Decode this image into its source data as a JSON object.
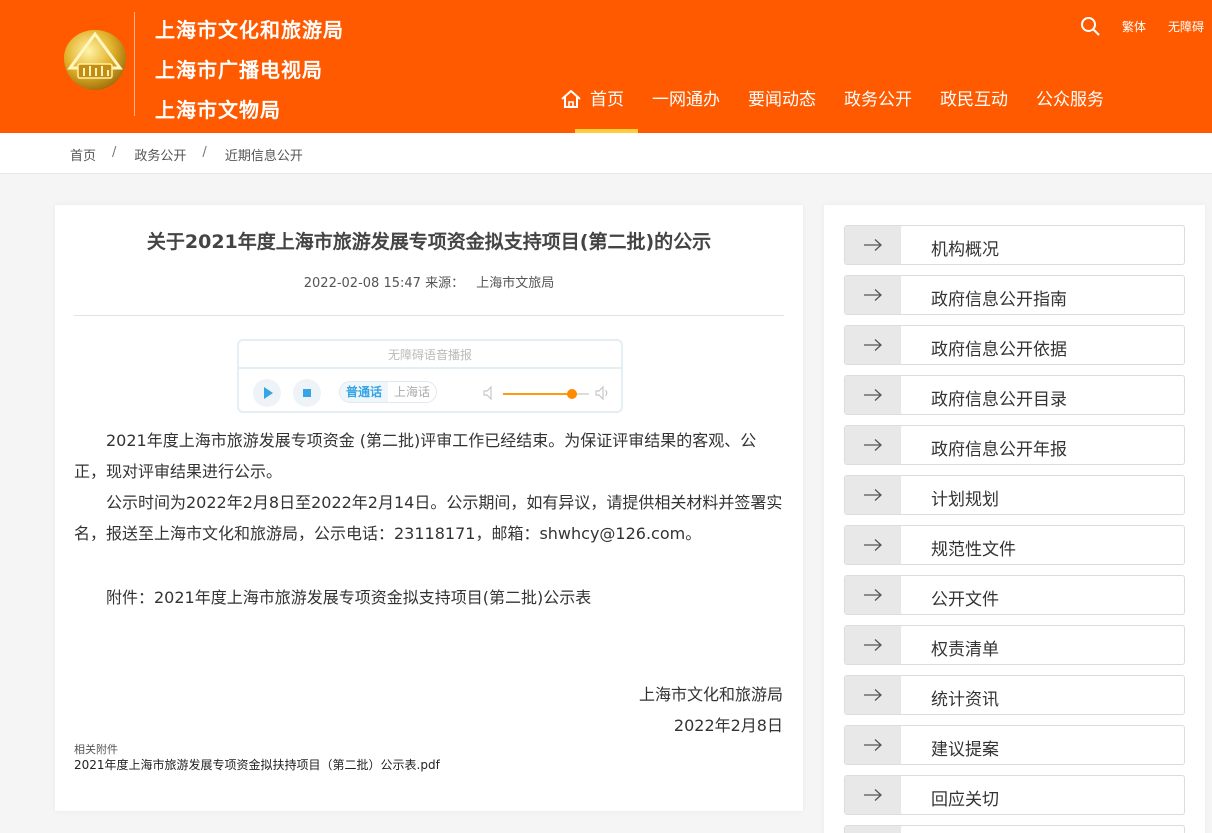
{
  "header": {
    "org_names": [
      "上海市文化和旅游局",
      "上海市广播电视局",
      "上海市文物局"
    ],
    "tools": {
      "traditional": "繁体",
      "accessibility": "无障碍"
    },
    "nav": [
      {
        "label": "首页",
        "active": true
      },
      {
        "label": "一网通办"
      },
      {
        "label": "要闻动态"
      },
      {
        "label": "政务公开"
      },
      {
        "label": "政民互动"
      },
      {
        "label": "公众服务"
      }
    ],
    "colors": {
      "brand": "#ff5a00",
      "nav_indicator": "#ffce3a"
    }
  },
  "breadcrumb": [
    "首页",
    "政务公开",
    "近期信息公开"
  ],
  "article": {
    "title": "关于2021年度上海市旅游发展专项资金拟支持项目(第二批)的公示",
    "datetime": "2022-02-08 15:47",
    "source_label": "来源：",
    "source": "上海市文旅局",
    "player": {
      "title": "无障碍语音播报",
      "lang_options": [
        "普通话",
        "上海话"
      ],
      "selected_lang": "普通话",
      "volume": 0.8
    },
    "paragraphs": [
      "2021年度上海市旅游发展专项资金 (第二批)评审工作已经结束。为保证评审结果的客观、公正，现对评审结果进行公示。",
      "公示时间为2022年2月8日至2022年2月14日。公示期间，如有异议，请提供相关材料并签署实名，报送至上海市文化和旅游局，公示电话：23118171，邮箱：shwhcy@126.com。",
      "附件：2021年度上海市旅游发展专项资金拟支持项目(第二批)公示表"
    ],
    "signature": "上海市文化和旅游局",
    "sign_date": "2022年2月8日",
    "attachment_label": "相关附件",
    "attachment_file": "2021年度上海市旅游发展专项资金拟扶持项目（第二批）公示表.pdf"
  },
  "sidebar": {
    "items": [
      "机构概况",
      "政府信息公开指南",
      "政府信息公开依据",
      "政府信息公开目录",
      "政府信息公开年报",
      "计划规划",
      "规范性文件",
      "公开文件",
      "权责清单",
      "统计资讯",
      "建议提案",
      "回应关切",
      ""
    ]
  }
}
